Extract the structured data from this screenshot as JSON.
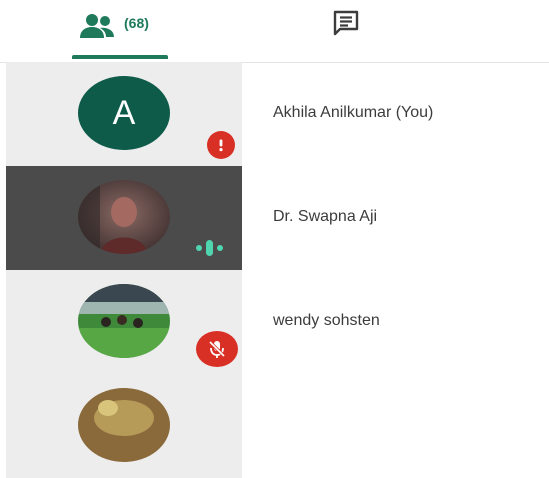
{
  "tabs": {
    "people": {
      "icon": "people-icon",
      "count": "(68)"
    },
    "chat": {
      "icon": "chat-icon"
    }
  },
  "participants": [
    {
      "name": "Akhila Anilkumar (You)",
      "avatar_letter": "A",
      "status_icon": "alert-icon"
    },
    {
      "name": "Dr. Swapna Aji",
      "status_icon": "speaking-icon"
    },
    {
      "name": "wendy sohsten",
      "status_icon": "mic-off-icon"
    },
    {
      "name": ""
    }
  ],
  "colors": {
    "accent": "#1e7a5a",
    "avatar_bg": "#0e5b4a",
    "alert": "#d93025",
    "speaking": "#4fd6b0",
    "active_row": "#4b4b4b"
  }
}
